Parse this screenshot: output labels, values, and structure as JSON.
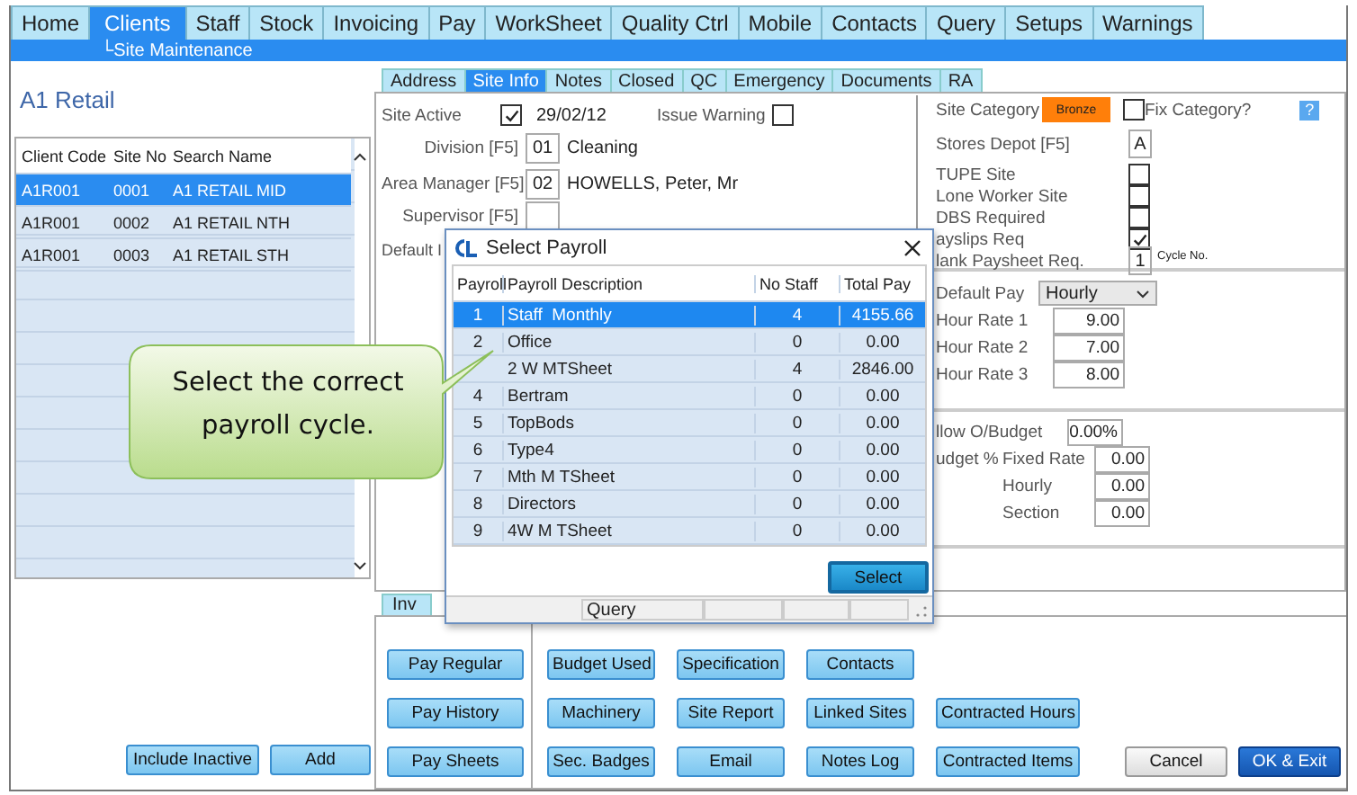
{
  "menu_tabs": [
    {
      "label": "Home",
      "selected": false
    },
    {
      "label": "Clients",
      "selected": true
    },
    {
      "label": "Staff",
      "selected": false
    },
    {
      "label": "Stock",
      "selected": false
    },
    {
      "label": "Invoicing",
      "selected": false
    },
    {
      "label": "Pay",
      "selected": false
    },
    {
      "label": "WorkSheet",
      "selected": false
    },
    {
      "label": "Quality Ctrl",
      "selected": false
    },
    {
      "label": "Mobile",
      "selected": false
    },
    {
      "label": "Contacts",
      "selected": false
    },
    {
      "label": "Query",
      "selected": false
    },
    {
      "label": "Setups",
      "selected": false
    },
    {
      "label": "Warnings",
      "selected": false
    }
  ],
  "breadcrumb": "└Site Maintenance",
  "client": {
    "name": "A1 Retail"
  },
  "sites": {
    "columns": [
      "Client Code",
      "Site No",
      "Search Name"
    ],
    "rows": [
      {
        "cells": [
          "A1R001",
          "0001",
          "A1 RETAIL MID"
        ],
        "selected": true
      },
      {
        "cells": [
          "A1R001",
          "0002",
          "A1 RETAIL NTH"
        ],
        "selected": false
      },
      {
        "cells": [
          "A1R001",
          "0003",
          "A1 RETAIL STH"
        ],
        "selected": false
      }
    ]
  },
  "left_buttons": [
    "Include Inactive",
    "Add"
  ],
  "site_tabs": [
    {
      "label": "Address",
      "selected": false
    },
    {
      "label": "Site Info",
      "selected": true
    },
    {
      "label": "Notes",
      "selected": false
    },
    {
      "label": "Closed",
      "selected": false
    },
    {
      "label": "QC",
      "selected": false
    },
    {
      "label": "Emergency",
      "selected": false
    },
    {
      "label": "Documents",
      "selected": false
    },
    {
      "label": "RA",
      "selected": false
    }
  ],
  "site_info": {
    "site_active": {
      "label": "Site Active",
      "checked": true,
      "date": "29/02/12"
    },
    "issue_warning": {
      "label": "Issue Warning",
      "checked": false
    },
    "fields": [
      {
        "label": "Division [F5]",
        "code": "01",
        "value": "Cleaning"
      },
      {
        "label": "Area Manager [F5]",
        "code": "02",
        "value": "HOWELLS, Peter, Mr"
      },
      {
        "label": "Supervisor [F5]"
      }
    ],
    "partial_label": "Default I"
  },
  "site_flags": {
    "category": {
      "label": "Site Category",
      "value": "Bronze"
    },
    "fix_category": {
      "label": "Fix Category?",
      "checked": false
    },
    "help": "?",
    "stores_depot": {
      "label": "Stores Depot [F5]",
      "value": "A"
    },
    "checks": [
      {
        "label": "TUPE Site",
        "checked": false
      },
      {
        "label": "Lone Worker Site",
        "checked": false
      },
      {
        "label": "DBS Required",
        "checked": false
      },
      {
        "label": "ayslips Req",
        "checked": true
      }
    ],
    "blank_paysheet": {
      "label": "lank Paysheet Req.",
      "value": "1",
      "note": "Cycle No."
    }
  },
  "pay": {
    "default_pay": {
      "label": "Default Pay",
      "value": "Hourly"
    },
    "rates": [
      {
        "label": "Hour Rate 1",
        "value": "9.00"
      },
      {
        "label": "Hour Rate 2",
        "value": "7.00"
      },
      {
        "label": "Hour Rate 3",
        "value": "8.00"
      }
    ]
  },
  "budget": {
    "allow_label": "llow O/Budget",
    "allow_value": "0.00%",
    "budget_label": "udget %",
    "items": [
      {
        "label": "Fixed Rate",
        "value": "0.00"
      },
      {
        "label": "Hourly",
        "value": "0.00"
      },
      {
        "label": "Section",
        "value": "0.00"
      }
    ]
  },
  "lower_tabs": [
    {
      "label": "Inv",
      "selected": false
    }
  ],
  "pay_buttons": [
    "Pay Regular",
    "Pay History",
    "Pay Sheets"
  ],
  "action_buttons": [
    [
      "Budget Used",
      "Specification",
      "Contacts"
    ],
    [
      "Machinery",
      "Site Report",
      "Linked Sites",
      "Contracted Hours"
    ],
    [
      "Sec. Badges",
      "Email",
      "Notes Log",
      "Contracted Items"
    ]
  ],
  "footer_buttons": [
    {
      "label": "Cancel",
      "kind": "secondary"
    },
    {
      "label": "OK & Exit",
      "kind": "primary"
    }
  ],
  "dialog": {
    "title": "Select Payroll",
    "columns": [
      "Payroll",
      "Payroll Description",
      "No Staff",
      "Total Pay"
    ],
    "rows": [
      {
        "cells": [
          "1",
          "Staff  Monthly",
          "4",
          "4155.66"
        ],
        "selected": true
      },
      {
        "cells": [
          "2",
          "Office",
          "0",
          "0.00"
        ],
        "selected": false
      },
      {
        "cells": [
          null,
          "2 W MTSheet",
          "4",
          "2846.00"
        ],
        "selected": false
      },
      {
        "cells": [
          "4",
          "Bertram",
          "0",
          "0.00"
        ],
        "selected": false
      },
      {
        "cells": [
          "5",
          "TopBods",
          "0",
          "0.00"
        ],
        "selected": false
      },
      {
        "cells": [
          "6",
          "Type4",
          "0",
          "0.00"
        ],
        "selected": false
      },
      {
        "cells": [
          "7",
          "Mth M TSheet",
          "0",
          "0.00"
        ],
        "selected": false
      },
      {
        "cells": [
          "8",
          "Directors",
          "0",
          "0.00"
        ],
        "selected": false
      },
      {
        "cells": [
          "9",
          "4W M TSheet",
          "0",
          "0.00"
        ],
        "selected": false
      }
    ],
    "button": "Select",
    "status": "Query"
  },
  "callout": {
    "text": "Select the correct payroll cycle."
  }
}
